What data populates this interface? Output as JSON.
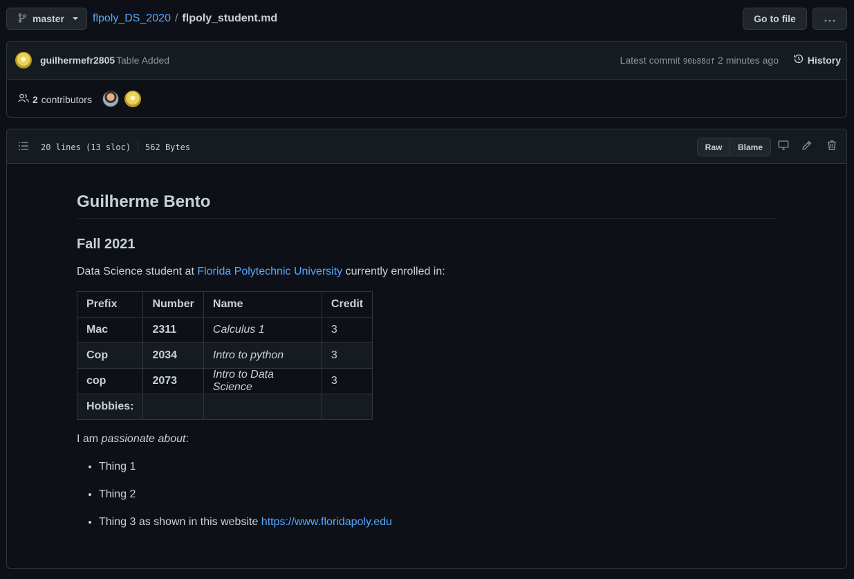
{
  "topbar": {
    "branch": "master",
    "repo": "flpoly_DS_2020",
    "separator": "/",
    "file": "flpoly_student.md",
    "go_to_file": "Go to file"
  },
  "commit": {
    "author": "guilhermefr2805",
    "message": "Table Added",
    "latest_label": "Latest commit",
    "sha": "90b88df",
    "time": "2 minutes ago",
    "history": "History"
  },
  "contributors": {
    "count": "2",
    "label": "contributors"
  },
  "file_header": {
    "lines": "20 lines (13 sloc)",
    "size": "562 Bytes",
    "raw": "Raw",
    "blame": "Blame"
  },
  "markdown": {
    "h1": "Guilherme Bento",
    "h2": "Fall 2021",
    "intro_before": "Data Science student at ",
    "intro_link": "Florida Polytechnic University",
    "intro_after": " currently enrolled in:",
    "table": {
      "headers": [
        "Prefix",
        "Number",
        "Name",
        "Credit"
      ],
      "rows": [
        [
          "Mac",
          "2311",
          "Calculus 1",
          "3"
        ],
        [
          "Cop",
          "2034",
          "Intro to python",
          "3"
        ],
        [
          "cop",
          "2073",
          "Intro to Data Science",
          "3"
        ],
        [
          "Hobbies:",
          "",
          "",
          ""
        ]
      ]
    },
    "passion_before": "I am ",
    "passion_em": "passionate about",
    "passion_after": ":",
    "list": [
      "Thing 1",
      "Thing 2",
      "Thing 3 as shown in this website "
    ],
    "list_link": "https://www.floridapoly.edu"
  },
  "icons": {
    "branch": "git-branch-icon",
    "more": "kebab-horizontal-icon",
    "history": "history-icon",
    "people": "people-icon",
    "toc": "list-unordered-icon",
    "display": "device-desktop-icon",
    "edit": "pencil-icon",
    "delete": "trash-icon"
  },
  "colors": {
    "background": "#0d1117",
    "panel": "#161b22",
    "border": "#30363d",
    "link": "#58a6ff",
    "text": "#c9d1d9",
    "muted": "#8b949e"
  }
}
